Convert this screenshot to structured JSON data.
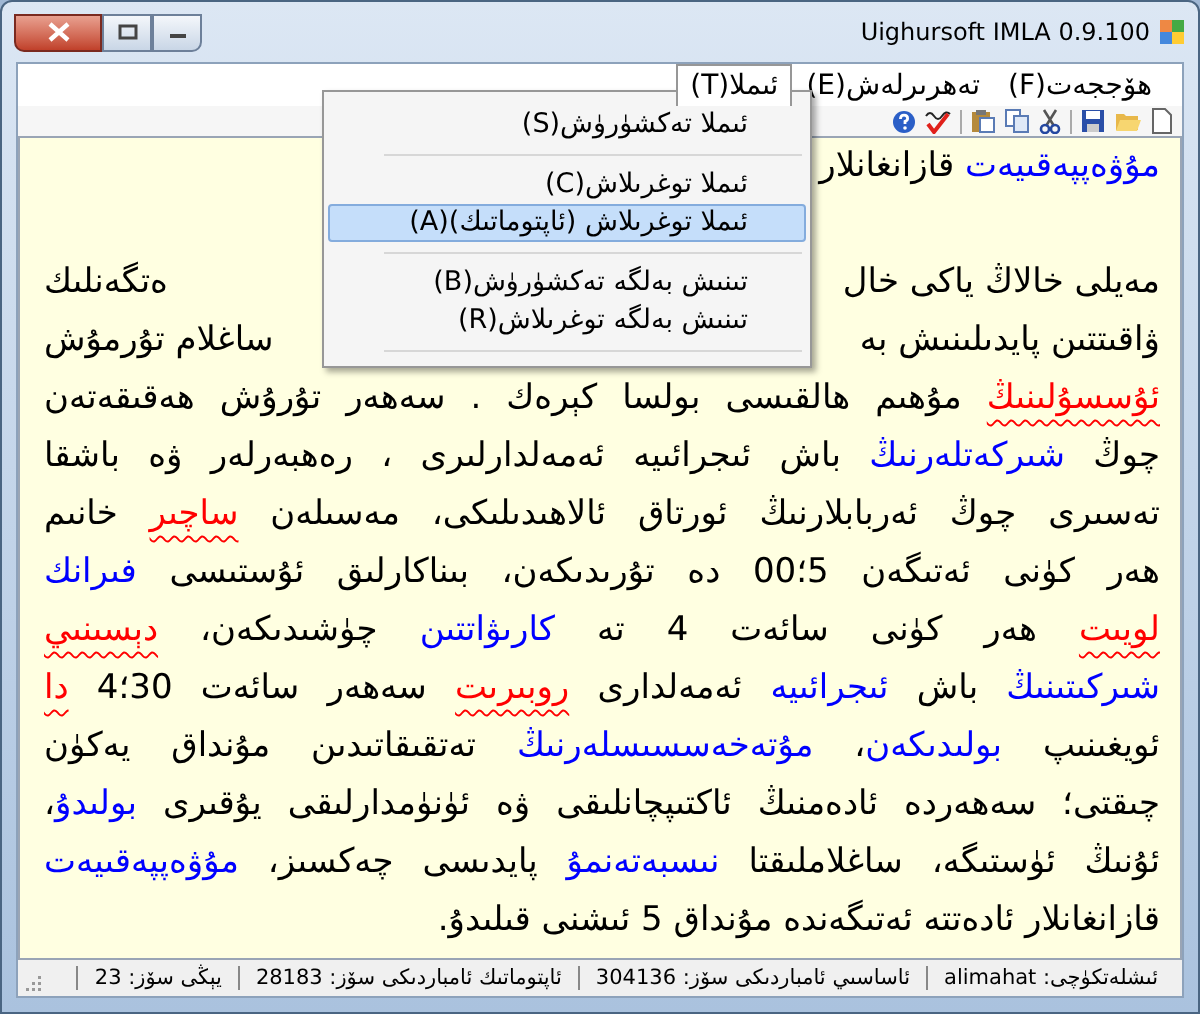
{
  "window": {
    "title": "Uighursoft IMLA 0.9.100"
  },
  "menu_bar": [
    {
      "label": "ھۆججەت(F)",
      "selected": false
    },
    {
      "label": "تەھرىرلەش(E)",
      "selected": false
    },
    {
      "label": "ئىملا(T)",
      "selected": true
    }
  ],
  "dropdown": [
    {
      "kind": "item",
      "label": "ئىملا تەكشۈرۈش(S)",
      "selected": false
    },
    {
      "kind": "separator"
    },
    {
      "kind": "item",
      "label": "ئىملا توغرىلاش(C)",
      "selected": false
    },
    {
      "kind": "item",
      "label": "ئىملا توغرىلاش (ئاپتوماتىك)(A)",
      "selected": true
    },
    {
      "kind": "separator"
    },
    {
      "kind": "item",
      "label": "تىنىش بەلگە تەكشۈرۈش(B)",
      "selected": false
    },
    {
      "kind": "item",
      "label": "تىنىش بەلگە توغرىلاش(R)",
      "selected": false
    },
    {
      "kind": "separator"
    }
  ],
  "document": {
    "paragraphs": [
      {
        "lines": [
          {
            "kind": "cut",
            "start": [
              {
                "text": "مۇۋەپپەقىيەت",
                "color": "#0000ff"
              },
              {
                "text": " قازانغانلار"
              }
            ]
          }
        ]
      },
      {
        "lines": [
          {
            "kind": "cut",
            "start": [
              {
                "text": "مەيلى خالاڭ ياكى خال"
              }
            ],
            "end": [
              {
                "text": "ەتگەنلىك"
              }
            ]
          },
          {
            "kind": "cut",
            "start": [
              {
                "text": "ۋاقىتتىن پايدىلىنىش بە"
              }
            ],
            "end": [
              {
                "text": "ساغلام تۇرمۇش"
              }
            ]
          },
          {
            "kind": "full",
            "start": [
              {
                "text": "ئۇسسۇلىنىڭ",
                "color": "#ff0000",
                "flagged": true
              },
              {
                "text": " مۇھىم ھالقىسى بولسا كېرەك . سەھەر تۇرۇش ھەقىقەتەن"
              }
            ]
          },
          {
            "kind": "full",
            "start": [
              {
                "text": "چوڭ "
              },
              {
                "text": "شىركەتلەرنىڭ",
                "color": "#0000ff"
              },
              {
                "text": " باش ئىجرائىيە ئەمەلدارلىرى ، رەھبەرلەر ۋە باشقا"
              }
            ]
          },
          {
            "kind": "full",
            "start": [
              {
                "text": "تەسىرى چوڭ ئەربابلارنىڭ ئورتاق ئالاھىدىلىكى، مەسىلەن "
              },
              {
                "text": "ساچىر",
                "color": "#ff0000",
                "flagged": true
              },
              {
                "text": " خانىم"
              }
            ]
          },
          {
            "kind": "full",
            "start": [
              {
                "text": "ھەر كۈنى ئەتىگەن 5؛00 دە تۇرىدىكەن، بىناكارلىق ئۇستىسى "
              },
              {
                "text": "فىرانك",
                "color": "#0000ff"
              }
            ]
          },
          {
            "kind": "full",
            "start": [
              {
                "text": "لويىت",
                "color": "#ff0000",
                "flagged": true
              },
              {
                "text": " ھەر كۈنى سائەت 4 تە "
              },
              {
                "text": "كارىۋاتتىن",
                "color": "#0000ff"
              },
              {
                "text": " چۈشىدىكەن، "
              },
              {
                "text": "دېسىنىي",
                "color": "#ff0000",
                "flagged": true
              }
            ]
          },
          {
            "kind": "full",
            "start": [
              {
                "text": "شىركىتىنىڭ",
                "color": "#0000ff"
              },
              {
                "text": " باش "
              },
              {
                "text": "ئىجرائىيە",
                "color": "#0000ff"
              },
              {
                "text": " ئەمەلدارى "
              },
              {
                "text": "روبىرىت",
                "color": "#ff0000",
                "flagged": true
              },
              {
                "text": " سەھەر سائەت 30؛4 "
              },
              {
                "text": "دا",
                "color": "#ff0000",
                "flagged": true
              }
            ]
          },
          {
            "kind": "full",
            "start": [
              {
                "text": "ئويغىنىپ "
              },
              {
                "text": "بولىدىكەن",
                "color": "#0000ff"
              },
              {
                "text": "، "
              },
              {
                "text": "مۇتەخەسسىسلەرنىڭ",
                "color": "#0000ff"
              },
              {
                "text": " تەتقىقاتىدىن مۇنداق يەكۈن"
              }
            ]
          },
          {
            "kind": "full",
            "start": [
              {
                "text": "چىقتى؛ سەھەردە ئادەمنىڭ ئاكتىپچانلىقى ۋە ئۈنۈمدارلىقى يۇقىرى "
              },
              {
                "text": "بولىدۇ",
                "color": "#0000ff"
              },
              {
                "text": "،"
              }
            ]
          },
          {
            "kind": "full",
            "start": [
              {
                "text": "ئۇنىڭ ئۈستىگە، ساغلاملىقتا "
              },
              {
                "text": "نىسبەتەنمۇ",
                "color": "#0000ff"
              },
              {
                "text": " پايدىسى چەكسىز، "
              },
              {
                "text": "مۇۋەپپەقىيەت",
                "color": "#0000ff"
              }
            ]
          },
          {
            "kind": "last",
            "start": [
              {
                "text": "قازانغانلار ئادەتتە ئەتىگەندە مۇنداق 5 ئىشنى قىلىدۇ."
              }
            ]
          }
        ]
      }
    ]
  },
  "status_bar": [
    "ئىشلەتكۈچى: alimahat",
    "ئاساسىي ئامباردىكى سۆز: 304136",
    "ئاپتوماتىك ئامباردىكى سۆز: 28183",
    "يېڭى سۆز: 23"
  ]
}
